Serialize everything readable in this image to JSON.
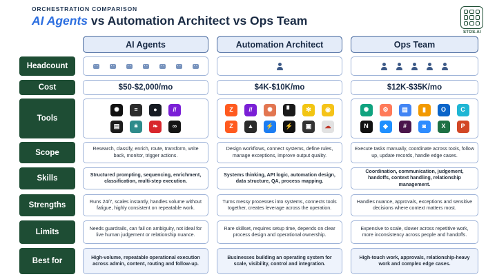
{
  "header": {
    "eyebrow": "ORCHESTRATION COMPARISON",
    "title_accent": "AI Agents",
    "title_rest": " vs Automation Architect vs Ops Team",
    "logo_text": "STOS.AI"
  },
  "columns": [
    "AI Agents",
    "Automation Architect",
    "Ops Team"
  ],
  "rows": {
    "headcount": {
      "label": "Headcount",
      "counts": [
        7,
        1,
        5
      ]
    },
    "cost": {
      "label": "Cost",
      "values": [
        "$50-$2,000/mo",
        "$4K-$10K/mo",
        "$12K-$35K/mo"
      ]
    },
    "tools": {
      "label": "Tools",
      "icons": [
        [
          {
            "name": "openai-icon",
            "color": "#111111",
            "glyph": "✺"
          },
          {
            "name": "perplexity-icon",
            "color": "#2b2b2b",
            "glyph": "≡"
          },
          {
            "name": "github-icon",
            "color": "#161b22",
            "glyph": "●"
          },
          {
            "name": "make-icon",
            "color": "#7a1fd6",
            "glyph": "//"
          },
          {
            "name": "claude-code-icon",
            "color": "#1c1c1c",
            "glyph": "▤"
          },
          {
            "name": "agent-icon",
            "color": "#2e8b8b",
            "glyph": "✶"
          },
          {
            "name": "n8n-icon",
            "color": "#d8262d",
            "glyph": "❧"
          },
          {
            "name": "loop-icon",
            "color": "#151515",
            "glyph": "∞"
          }
        ],
        [
          {
            "name": "zapier-icon",
            "color": "#ff5a1f",
            "glyph": "Z"
          },
          {
            "name": "make-icon",
            "color": "#7a1fd6",
            "glyph": "//"
          },
          {
            "name": "claude-icon",
            "color": "#e27651",
            "glyph": "✺"
          },
          {
            "name": "clay-icon",
            "color": "#1a1a1a",
            "glyph": "▘"
          },
          {
            "name": "spark-icon",
            "color": "#f2c512",
            "glyph": "✻"
          },
          {
            "name": "airtable-icon",
            "color": "#f5c318",
            "glyph": "◉"
          },
          {
            "name": "zapier-alt-icon",
            "color": "#ff5a1f",
            "glyph": "Z"
          },
          {
            "name": "tally-icon",
            "color": "#2a2a2a",
            "glyph": "▲"
          },
          {
            "name": "bolt-icon",
            "color": "#1c7df2",
            "glyph": "⚡"
          },
          {
            "name": "bolt-alt-icon",
            "color": "#111111",
            "glyph": "⚡"
          },
          {
            "name": "notion-box-icon",
            "color": "#333333",
            "glyph": "▣"
          },
          {
            "name": "cloud-icon",
            "color": "#e2e2e2",
            "glyph": "☁"
          }
        ],
        [
          {
            "name": "openai-icon",
            "color": "#10a37f",
            "glyph": "✺"
          },
          {
            "name": "hubspot-icon",
            "color": "#ff7a59",
            "glyph": "⚙"
          },
          {
            "name": "docs-icon",
            "color": "#4285f4",
            "glyph": "▤"
          },
          {
            "name": "analytics-icon",
            "color": "#f29900",
            "glyph": "▮"
          },
          {
            "name": "outlook-icon",
            "color": "#0a64c9",
            "glyph": "O"
          },
          {
            "name": "canva-icon",
            "color": "#1fb6d4",
            "glyph": "C"
          },
          {
            "name": "notion-icon",
            "color": "#111111",
            "glyph": "N"
          },
          {
            "name": "airtable-icon",
            "color": "#1f8fff",
            "glyph": "◆"
          },
          {
            "name": "slack-icon",
            "color": "#4a154b",
            "glyph": "#"
          },
          {
            "name": "zoom-icon",
            "color": "#2d8cff",
            "glyph": "◙"
          },
          {
            "name": "excel-icon",
            "color": "#1d7044",
            "glyph": "X"
          },
          {
            "name": "powerpoint-icon",
            "color": "#d24726",
            "glyph": "P"
          }
        ]
      ]
    },
    "scope": {
      "label": "Scope",
      "values": [
        "Research, classify, enrich, route, transform, write back, monitor, trigger actions.",
        "Design workflows, connect systems, define rules, manage exceptions, improve output quality.",
        "Execute tasks manually, coordinate across tools, follow up, update records, handle edge cases."
      ]
    },
    "skills": {
      "label": "Skills",
      "values": [
        "Structured prompting, sequencing, enrichment, classification, multi-step execution.",
        "Systems thinking, API logic, automation design, data structure, QA, process mapping.",
        "Coordination, communication, judgement, handoffs, context handling, relationship management."
      ]
    },
    "strengths": {
      "label": "Strengths",
      "values": [
        "Runs 24/7, scales instantly, handles volume without fatigue, highly consistent on repeatable work.",
        "Turns messy processes into systems, connects tools together, creates leverage across the operation.",
        "Handles nuance, approvals, exceptions and sensitive decisions where context matters most."
      ]
    },
    "limits": {
      "label": "Limits",
      "values": [
        "Needs guardrails, can fail on ambiguity, not ideal for live human judgement or relationship nuance.",
        "Rare skillset, requires setup time, depends on clear process design and operational ownership.",
        "Expensive to scale, slower across repetitive work, more inconsistency across people and handoffs."
      ]
    },
    "best_for": {
      "label": "Best for",
      "values": [
        "High-volume, repeatable operational execution across admin, content, routing and follow-up.",
        "Businesses building an operating system for scale, visibility, control and integration.",
        "High-touch work, approvals, relationship-heavy work and complex edge cases."
      ]
    }
  }
}
